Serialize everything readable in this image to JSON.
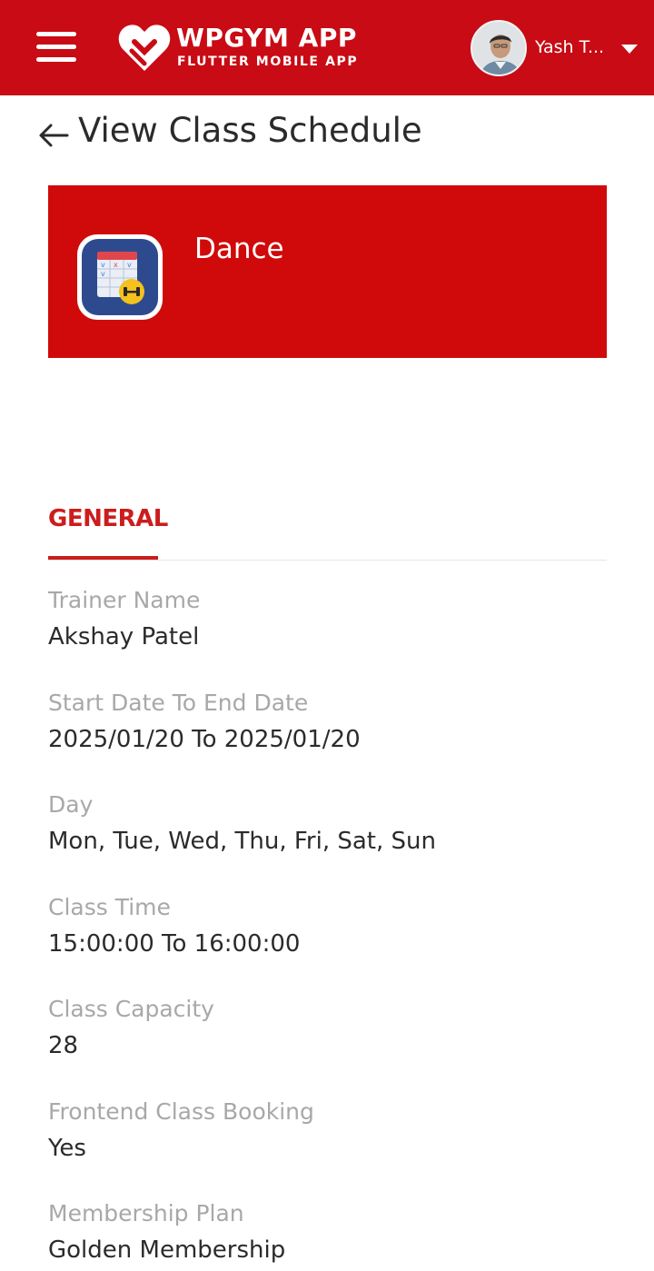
{
  "header": {
    "brand_title": "WPGYM APP",
    "brand_subtitle": "FLUTTER MOBILE APP",
    "user_name": "Yash T...",
    "colors": {
      "primary": "#c80b14",
      "on_primary": "#ffffff"
    },
    "menu_icon": "hamburger-menu-icon",
    "dropdown_icon": "caret-down-icon"
  },
  "page": {
    "title": "View Class Schedule",
    "back_icon": "arrow-left-icon"
  },
  "class_card": {
    "name": "Dance",
    "icon": "calendar-dumbbell-icon",
    "background": "#d00a0a"
  },
  "tabs": {
    "active_label": "GENERAL",
    "active_color": "#cc1d1d"
  },
  "details": [
    {
      "label": "Trainer Name",
      "value": "Akshay Patel"
    },
    {
      "label": "Start Date To End Date",
      "value": "2025/01/20 To 2025/01/20"
    },
    {
      "label": "Day",
      "value": "Mon, Tue, Wed, Thu, Fri, Sat, Sun"
    },
    {
      "label": "Class Time",
      "value": "15:00:00 To 16:00:00"
    },
    {
      "label": "Class Capacity",
      "value": "28"
    },
    {
      "label": "Frontend Class Booking",
      "value": "Yes"
    },
    {
      "label": "Membership Plan",
      "value": "Golden Membership"
    }
  ]
}
